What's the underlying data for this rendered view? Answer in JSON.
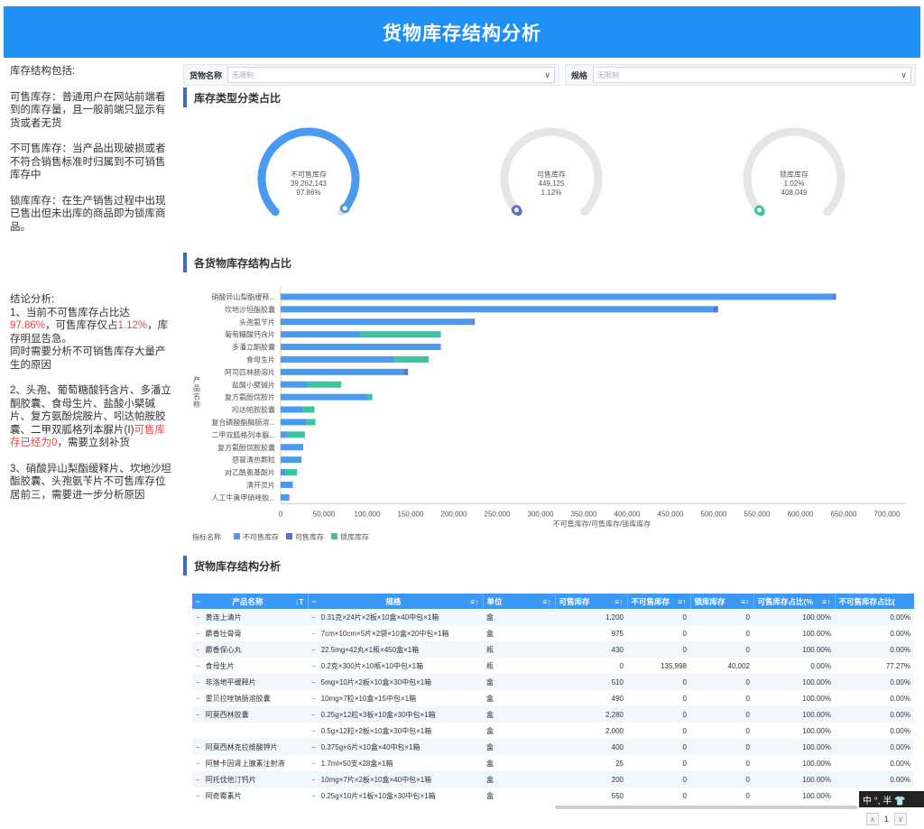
{
  "header": {
    "title": "货物库存结构分析"
  },
  "left_panel": {
    "intro_title": "库存结构包括:",
    "para1": "可售库存：普通用户在网站前端看到的库存量，且一般前端只显示有货或者无货",
    "para2": "不可售库存：当产品出现破损或者不符合销售标准时归属到不可销售库存中",
    "para3": "锁库库存：在生产销售过程中出现已售出但未出库的商品即为锁库商品。",
    "conclusion_title": "结论分析:",
    "c1_a": "1、当前不可售库存占比达",
    "c1_b": "97.86%",
    "c1_c": "，可售库存仅占",
    "c1_d": "1.12%",
    "c1_e": "，库存明显告急。",
    "c1_f": "同时需要分析不可销售库存大量产生的原因",
    "c2_a": "2、头孢、葡萄糖酸钙含片、多潘立酮胶囊、食母生片、盐酸小檗碱片、复方氨酚烷胺片、吲达帕胺胶囊、二甲双胍格列本脲片(Ⅰ)",
    "c2_b": "可售库存已经为0",
    "c2_c": "，需要立刻补货",
    "c3": "3、硝酸异山梨酯缓释片、坎地沙坦酯胶囊、头孢氨苄片不可售库存位居前三，需要进一步分析原因"
  },
  "filters": {
    "goods_label": "货物名称",
    "goods_value": "无限制",
    "spec_label": "规格",
    "spec_value": "无限制"
  },
  "sections": {
    "type_ratio": "库存类型分类占比",
    "goods_ratio": "各货物库存结构占比",
    "table_title": "货物库存结构分析"
  },
  "gauges": [
    {
      "name": "不可售库存",
      "value": "39,262,143",
      "pct": "97.86%",
      "ratio": 0.9786,
      "color": "#4a9af0"
    },
    {
      "name": "可售库存",
      "value": "449,125",
      "pct": "1.12%",
      "ratio": 0.0112,
      "color": "#5b6fd6"
    },
    {
      "name": "锁库库存",
      "pct": "1.02%",
      "value": "408,049",
      "ratio": 0.0102,
      "color": "#3cc3a0"
    }
  ],
  "chart_data": {
    "type": "bar",
    "orientation": "horizontal",
    "stacked": true,
    "ylabel": "产品名称",
    "xlabel": "不可售库存/可售库存/锁库库存",
    "legend_title": "指标名称",
    "xlim": [
      0,
      700000
    ],
    "xticks": [
      "0",
      "50,000",
      "100,000",
      "150,000",
      "200,000",
      "250,000",
      "300,000",
      "350,000",
      "400,000",
      "450,000",
      "500,000",
      "550,000",
      "600,000",
      "650,000",
      "700,000"
    ],
    "categories": [
      "硝酸异山梨酯缓释...",
      "坎地沙坦酯胶囊",
      "头孢氨苄片",
      "葡萄糖酸钙含片",
      "多潘立酮胶囊",
      "食母生片",
      "阿司匹林肠溶片",
      "盐酸小檗碱片",
      "复方氨酚烷胺片",
      "吲达帕胺胶囊",
      "复合磷酸酯酶肠溶...",
      "二甲双胍格列本脲...",
      "复方氨酚烷胺胶囊",
      "感冒清热颗粒",
      "对乙酰氨基酚片",
      "清开灵片",
      "人工牛黄甲硝唑胶..."
    ],
    "series": [
      {
        "name": "不可售库存",
        "color": "#4a9af0",
        "values": [
          638000,
          500000,
          222000,
          92000,
          185000,
          131000,
          142000,
          32000,
          100000,
          25000,
          30000,
          8000,
          26000,
          24000,
          3000,
          14000,
          9000
        ]
      },
      {
        "name": "可售库存",
        "color": "#5b6fd6",
        "values": [
          3000,
          5000,
          2000,
          0,
          0,
          0,
          5000,
          0,
          0,
          0,
          0,
          0,
          0,
          0,
          2000,
          0,
          1000
        ]
      },
      {
        "name": "锁库库存",
        "color": "#3cc3a0",
        "values": [
          0,
          0,
          0,
          93000,
          0,
          40000,
          0,
          38000,
          6000,
          14000,
          10000,
          20000,
          0,
          0,
          14000,
          0,
          0
        ]
      }
    ]
  },
  "table": {
    "headers": [
      "产品名称",
      "规格",
      "单位",
      "可售库存",
      "不可售库存",
      "锁库库存",
      "可售库存占比(%",
      "不可售库存占比("
    ],
    "rows": [
      {
        "name": "黄连上清片",
        "spec": "0.31克×24片×2板×10盒×40中包×1箱",
        "unit": "盒",
        "avail": "1,200",
        "unavail": "0",
        "lock": "0",
        "avail_pct": "100.00%",
        "unavail_pct": "0.00%"
      },
      {
        "name": "麝香壮骨膏",
        "spec": "7cm×10cm×5片×2袋×10盒×20中包×1箱",
        "unit": "盒",
        "avail": "975",
        "unavail": "0",
        "lock": "0",
        "avail_pct": "100.00%",
        "unavail_pct": "0.00%"
      },
      {
        "name": "麝香保心丸",
        "spec": "22.5mg×42丸×1瓶×450盒×1箱",
        "unit": "瓶",
        "avail": "430",
        "unavail": "0",
        "lock": "0",
        "avail_pct": "100.00%",
        "unavail_pct": "0.00%"
      },
      {
        "name": "食母生片",
        "spec": "0.2克×300片×10瓶×10中包×1箱",
        "unit": "瓶",
        "avail": "0",
        "unavail": "135,998",
        "lock": "40,002",
        "avail_pct": "0.00%",
        "unavail_pct": "77.27%"
      },
      {
        "name": "非洛地平缓释片",
        "spec": "5mg×10片×2板×10盒×30中包×1箱",
        "unit": "盒",
        "avail": "510",
        "unavail": "0",
        "lock": "0",
        "avail_pct": "100.00%",
        "unavail_pct": "0.00%"
      },
      {
        "name": "雷贝拉唑钠肠溶胶囊",
        "spec": "10mg×7粒×10盒×15中包×1箱",
        "unit": "盒",
        "avail": "490",
        "unavail": "0",
        "lock": "0",
        "avail_pct": "100.00%",
        "unavail_pct": "0.00%"
      },
      {
        "name": "阿莫西林胶囊",
        "spec": "0.25g×12粒×3板×10盒×30中包×1箱",
        "unit": "盒",
        "avail": "2,280",
        "unavail": "0",
        "lock": "0",
        "avail_pct": "100.00%",
        "unavail_pct": "0.00%"
      },
      {
        "name": "",
        "spec": "0.5g×12粒×2板×10盒×30中包×1箱",
        "unit": "盒",
        "avail": "2,000",
        "unavail": "0",
        "lock": "0",
        "avail_pct": "100.00%",
        "unavail_pct": "0.00%"
      },
      {
        "name": "阿莫西林克拉维酸钾片",
        "spec": "0.375g×6片×10盒×40中包×1箱",
        "unit": "盒",
        "avail": "400",
        "unavail": "0",
        "lock": "0",
        "avail_pct": "100.00%",
        "unavail_pct": "0.00%"
      },
      {
        "name": "阿替卡因肾上腺素注射液",
        "spec": "1.7ml×50支×28盒×1箱",
        "unit": "盒",
        "avail": "25",
        "unavail": "0",
        "lock": "0",
        "avail_pct": "100.00%",
        "unavail_pct": "0.00%"
      },
      {
        "name": "阿托伐他汀钙片",
        "spec": "10mg×7片×2板×10盒×40中包×1箱",
        "unit": "盒",
        "avail": "200",
        "unavail": "0",
        "lock": "0",
        "avail_pct": "100.00%",
        "unavail_pct": "0.00%"
      },
      {
        "name": "阿奇霉素片",
        "spec": "0.25g×10片×1板×10盒×30中包×1箱",
        "unit": "盒",
        "avail": "550",
        "unavail": "0",
        "lock": "0",
        "avail_pct": "100.00%",
        "unavail_pct": "0.00%"
      }
    ]
  },
  "ime": {
    "label": "中 °, 半 👕"
  },
  "pager": {
    "page": "1"
  }
}
